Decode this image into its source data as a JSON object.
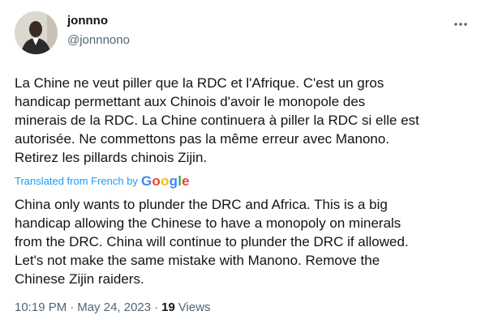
{
  "user": {
    "display_name": "jonnno",
    "handle": "@jonnnono",
    "avatar": "avatar-photo"
  },
  "more_icon": "more-horizontal-icon",
  "tweet": {
    "text_original": "La Chine ne veut piller que la RDC et l'Afrique. C'est un gros\nhandicap permettant aux Chinois d'avoir le monopole des\nminerais de la RDC. La Chine continuera à piller la RDC si elle est\nautorisée. Ne commettons pas la même erreur avec Manono.\nRetirez les pillards chinois Zijin.",
    "translated_label": "Translated from French by",
    "translator_logo": "Google",
    "text_translated": "China only wants to plunder the DRC and Africa. This is a big\nhandicap allowing the Chinese to have a monopoly on minerals\nfrom the DRC. China will continue to plunder the DRC if allowed.\nLet's not make the same mistake with Manono. Remove the\nChinese Zijin raiders."
  },
  "meta": {
    "time": "10:19 PM",
    "separator": "·",
    "date": "May 24, 2023",
    "views_count": "19",
    "views_label": "Views"
  },
  "colors": {
    "link": "#1d9bf0",
    "secondary": "#536471",
    "primary": "#0f1419"
  }
}
